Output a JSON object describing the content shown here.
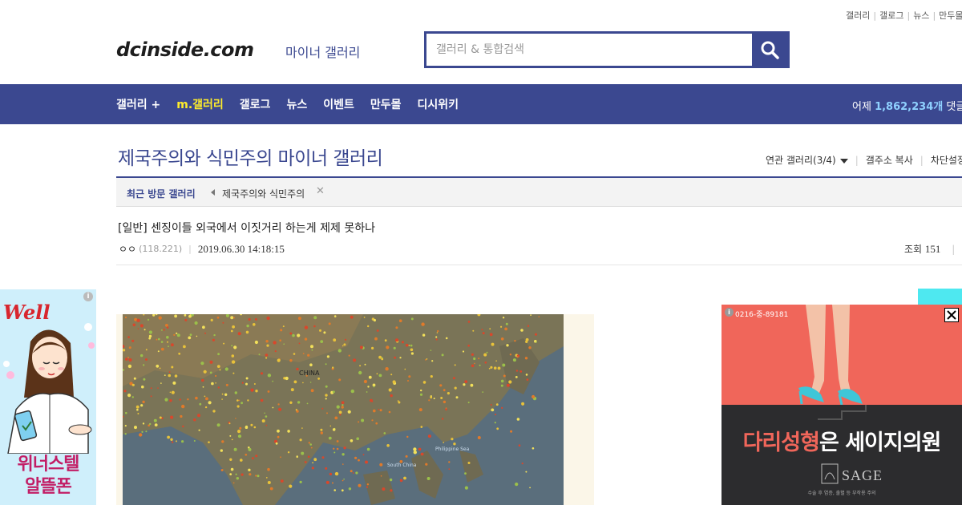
{
  "top_links": [
    "갤러리",
    "갤로그",
    "뉴스",
    "만두몰"
  ],
  "logo": {
    "text": "dcinside.com",
    "sub": "마이너 갤러리"
  },
  "search": {
    "placeholder": "갤러리 & 통합검색",
    "icon": "search-icon"
  },
  "nav": {
    "items": [
      {
        "label": "갤러리 +",
        "active": false
      },
      {
        "label": "m.갤러리",
        "active": true
      },
      {
        "label": "갤로그",
        "active": false
      },
      {
        "label": "뉴스",
        "active": false
      },
      {
        "label": "이벤트",
        "active": false
      },
      {
        "label": "만두몰",
        "active": false
      },
      {
        "label": "디시위키",
        "active": false
      }
    ],
    "stat_prefix": "어제",
    "stat_value": "1,862,234개",
    "stat_suffix": "댓글"
  },
  "gallery": {
    "title": "제국주의와 식민주의 마이너 갤러리",
    "tools": {
      "related": "연관 갤러리(3/4)",
      "copy": "갤주소 복사",
      "block": "차단설정"
    }
  },
  "recent": {
    "label": "최근 방문 갤러리",
    "item": "제국주의와 식민주의"
  },
  "post": {
    "title": "[일반] 센징이들 외국에서 이짓거리 하는게 제제 못하나",
    "author": "ㅇㅇ",
    "ip": "(118.221)",
    "date": "2019.06.30 14:18:15",
    "views_label": "조회",
    "views": "151"
  },
  "ad_left": {
    "brand": "Well",
    "copy_line1": "위너스텔",
    "copy_line2": "알뜰폰"
  },
  "ad_right": {
    "code": "0216-중-89181",
    "headline_pink": "다리성형",
    "headline_rest": "은 세이지의원",
    "brand": "SAGE",
    "fine_print": "수술 후 염증, 출혈 등 부작용 주의"
  },
  "map_labels": {
    "china": "CHINA",
    "sea": "Philippine Sea",
    "scs": "South China"
  },
  "colors": {
    "brand_blue": "#3b4890",
    "nav_active": "#ffed2b",
    "ad_red": "#f0665a"
  }
}
